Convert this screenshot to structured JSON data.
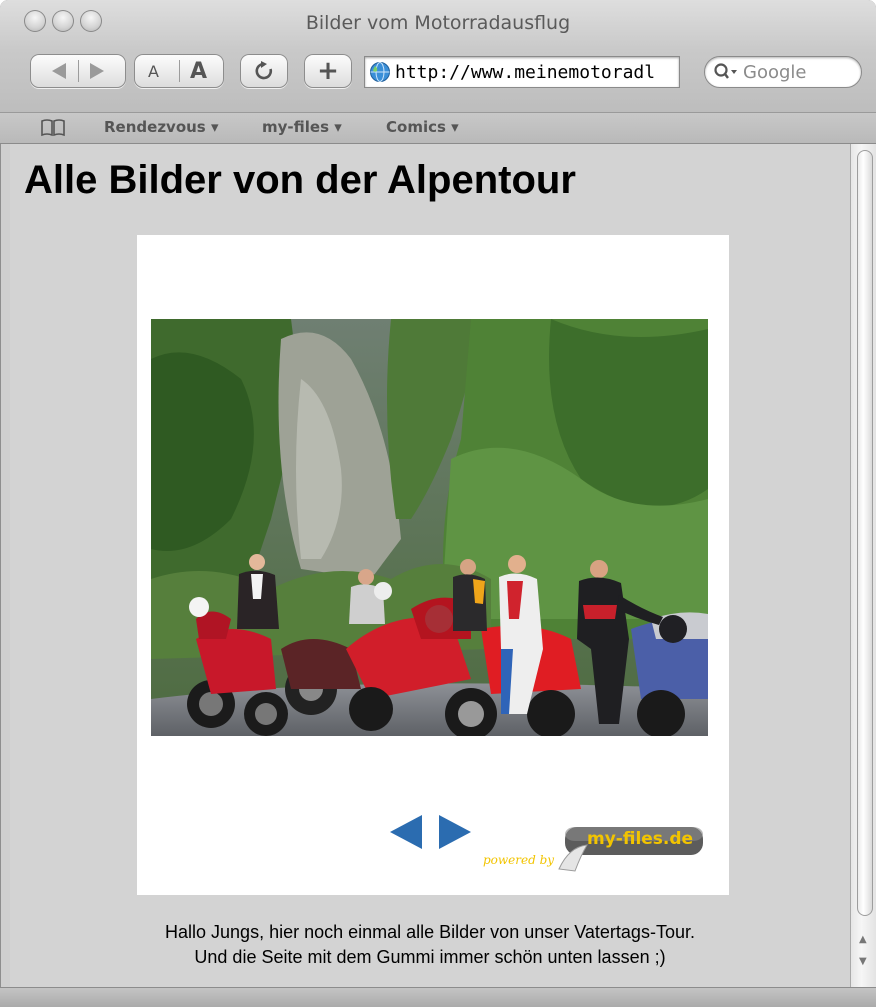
{
  "window": {
    "title": "Bilder vom Motorradausflug"
  },
  "toolbar": {
    "back_icon": "back-arrow-icon",
    "forward_icon": "forward-arrow-icon",
    "text_smaller_label": "A",
    "text_bigger_label": "A",
    "reload_icon": "reload-icon",
    "add_bookmark_label": "+",
    "url": "http://www.meinemotoradl",
    "search_placeholder": "Google"
  },
  "bookmarks_bar": {
    "items": [
      {
        "label": "Rendezvous ▾"
      },
      {
        "label": "my-files ▾"
      },
      {
        "label": "Comics ▾"
      }
    ]
  },
  "page": {
    "heading": "Alle Bilder von der Alpentour",
    "gallery": {
      "logo_text": "my-files.de",
      "powered_text": "powered by"
    },
    "caption_line1": "Hallo Jungs, hier noch einmal alle Bilder von unser Vatertags-Tour.",
    "caption_line2": "Und die Seite mit dem Gummi immer schön unten lassen ;)"
  },
  "colors": {
    "page_background": "#d3d3d3",
    "nav_arrow": "#2b6cb0",
    "logo_yellow": "#f2c400"
  }
}
